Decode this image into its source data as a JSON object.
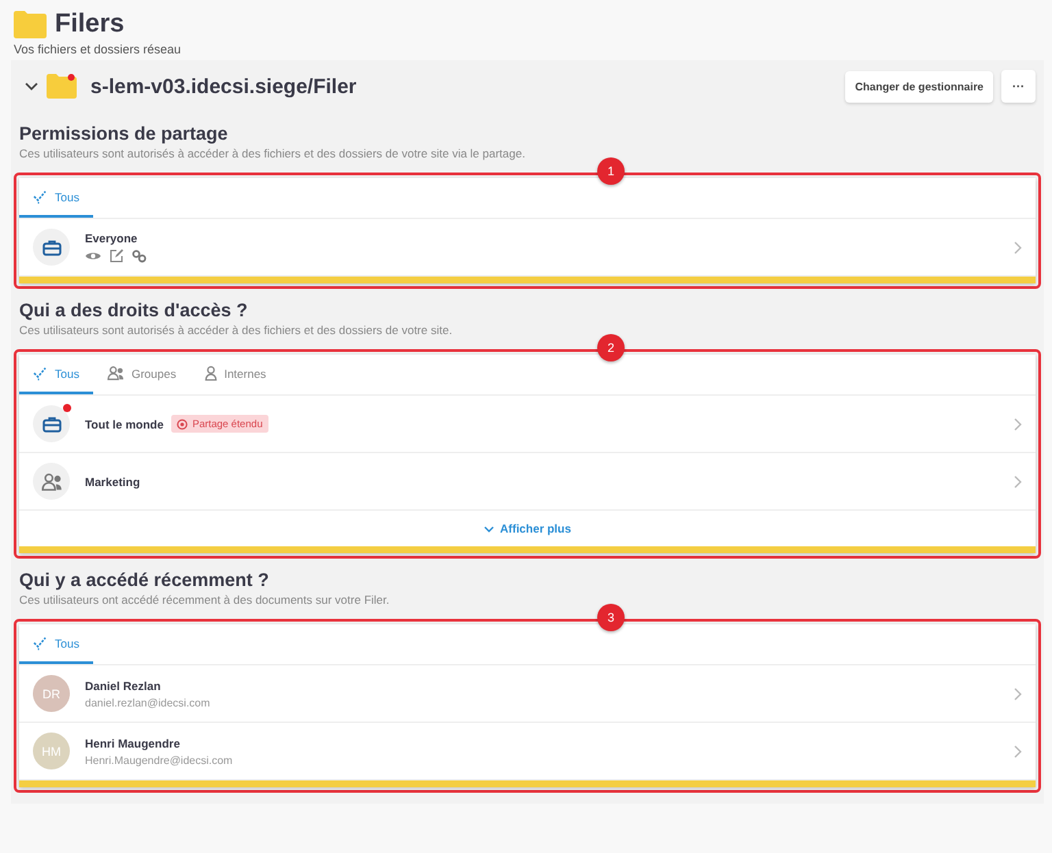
{
  "header": {
    "title": "Filers",
    "subtitle": "Vos fichiers et dossiers réseau"
  },
  "filer": {
    "name": "s-lem-v03.idecsi.siege/Filer",
    "expanded": true,
    "alert": true,
    "buttons": [
      {
        "kind": "text",
        "label": "Changer de gestionnaire"
      },
      {
        "kind": "more",
        "label": "···"
      }
    ]
  },
  "sections": [
    {
      "title": "Permissions de partage",
      "description": "Ces utilisateurs sont autorisés à accéder à des fichiers et des dossiers de votre site via le partage.",
      "callout": "1",
      "tabs": [
        {
          "label": "Tous",
          "kind": "all",
          "selected": true
        }
      ],
      "rows": [
        {
          "kind": "org",
          "name": "Everyone",
          "alert": false,
          "permissions": [
            {
              "kind": "view"
            },
            {
              "kind": "edit"
            },
            {
              "kind": "manage"
            }
          ]
        }
      ]
    },
    {
      "title": "Qui a des droits d'accès ?",
      "description": "Ces utilisateurs sont autorisés à accéder à des fichiers et des dossiers de votre site.",
      "callout": "2",
      "tabs": [
        {
          "label": "Tous",
          "kind": "all",
          "selected": true
        },
        {
          "label": "Groupes",
          "kind": "groups",
          "selected": false
        },
        {
          "label": "Internes",
          "kind": "internal",
          "selected": false
        }
      ],
      "rows": [
        {
          "kind": "org",
          "name": "Tout le monde",
          "alert": true,
          "badge": "Partage étendu"
        },
        {
          "kind": "group",
          "name": "Marketing",
          "alert": false
        }
      ],
      "show_more": "Afficher plus"
    },
    {
      "title": "Qui y a accédé récemment ?",
      "description": "Ces utilisateurs ont accédé récemment à des documents sur votre Filer.",
      "callout": "3",
      "tabs": [
        {
          "label": "Tous",
          "kind": "all",
          "selected": true
        }
      ],
      "rows": [
        {
          "kind": "person",
          "initials": "DR",
          "color": "#d9c1b8",
          "name": "Daniel Rezlan",
          "email": "daniel.rezlan@idecsi.com"
        },
        {
          "kind": "person",
          "initials": "HM",
          "color": "#dcd4bd",
          "name": "Henri Maugendre",
          "email": "Henri.Maugendre@idecsi.com"
        }
      ]
    }
  ]
}
